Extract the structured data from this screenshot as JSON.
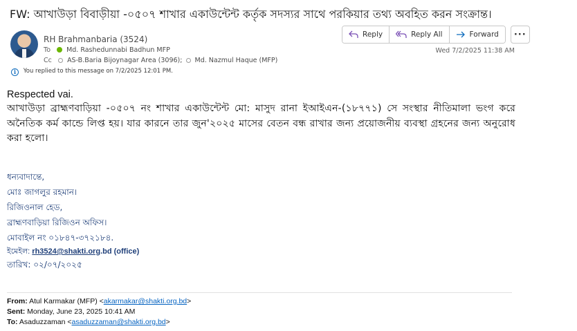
{
  "subject": "FW:  আখাউড়া বিবাড়ীয়া -০৫০৭ শাখার একাউন্টেন্ট কর্তৃক  সদস্যর সাথে পরকিয়ার তথ্য অবহিত করন সংক্রান্ত।",
  "header": {
    "sender": "RH Brahmanbaria (3524)",
    "to_label": "To",
    "to": "Md. Rashedunnabi Badhun MFP",
    "cc_label": "Cc",
    "cc_1": "AS-B.Baria Bijoynagar Area (3096);",
    "cc_2": "Md. Nazmul Haque (MFP)",
    "date": "Wed 7/2/2025 11:38 AM",
    "replied_note": "You replied to this message on 7/2/2025 12:01 PM."
  },
  "actions": {
    "reply": "Reply",
    "reply_all": "Reply All",
    "forward": "Forward",
    "more": "···"
  },
  "colors": {
    "accent": "#0f6cbd",
    "signature": "#1f3f79",
    "presence_available": "#6bb700"
  },
  "message": {
    "greeting": "Respected vai.",
    "body": "আখাউড়া ব্রাহ্মণবাড়িয়া -০৫০৭ নং শাখার একাউন্টেন্ট মো: মাসুদ রানা ইআইএন-(১৮৭৭১) সে সংস্থার নীতিমালা ভংগ করে অনৈতিক কর্ম কান্ডে লিপ্ত হয়। যার কারনে তার জুন'২০২৫ মাসের বেতন বন্ধ রাখার জন্য প্রয়োজনীয় ব্যবস্থা গ্রহনের জন্য অনুরোধ করা হলো।"
  },
  "signature": {
    "thanks": "ধন্যবাদান্তে,",
    "name": "মোঃ জাগলুর রহমান।",
    "designation": "রিজিওনাল হেড,",
    "office": "ব্রাহ্মণবাড়িয়া রিজিওন অফিস।",
    "mobile": "মোবাইল নং ০১৮৪৭-৩৭২১৮৪.",
    "email_label": "ইমেইল:",
    "email_link": "rh3524@shakti.org",
    "email_suffix": ".bd (office)",
    "date": "তারিখ: ০২/০৭/২০২৫"
  },
  "forwarded": {
    "from_label": "From:",
    "from_name": "Atul Karmakar (MFP) <",
    "from_email": "akarmakar@shakti.org.bd",
    "from_close": ">",
    "sent_label": "Sent:",
    "sent_value": "Monday, June 23, 2025 10:41 AM",
    "to_label": "To:",
    "to_name": "Asaduzzaman <",
    "to_email": "asaduzzaman@shakti.org.bd",
    "to_close": ">"
  }
}
